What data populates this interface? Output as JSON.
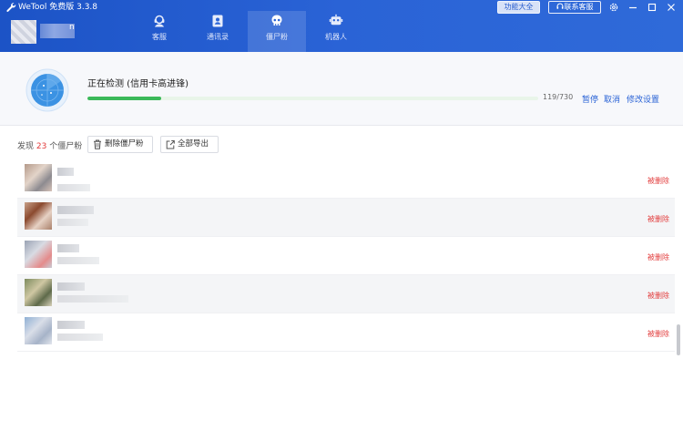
{
  "app": {
    "title": "WeTool 免费版 3.3.8",
    "account_suffix": "n"
  },
  "nav": {
    "tabs": [
      {
        "label": "客服",
        "icon": "customer-service-icon"
      },
      {
        "label": "通讯录",
        "icon": "contacts-icon"
      },
      {
        "label": "僵尸粉",
        "icon": "skull-icon"
      },
      {
        "label": "机器人",
        "icon": "robot-icon"
      }
    ],
    "active_tab": "僵尸粉"
  },
  "top_buttons": {
    "features": "功能大全",
    "support": "联系客服"
  },
  "scan": {
    "status": "正在检测 (信用卡高进锋)",
    "progress": {
      "current": 119,
      "total": 730,
      "text": "119/730"
    },
    "pause": "暂停",
    "cancel": "取消",
    "settings": "修改设置"
  },
  "toolbar": {
    "found_prefix": "发现",
    "found_count": "23",
    "found_suffix": "个僵尸粉",
    "delete_button": "删除僵尸粉",
    "export_button": "全部导出"
  },
  "list": {
    "rows": [
      {
        "status": "被删除"
      },
      {
        "status": "被删除"
      },
      {
        "status": "被删除"
      },
      {
        "status": "被删除"
      },
      {
        "status": "被删除"
      }
    ]
  },
  "colors": {
    "header": "#2a63d6",
    "accent": "#2a63d6",
    "progress": "#3cb95a",
    "deleted": "#e23c3c"
  }
}
